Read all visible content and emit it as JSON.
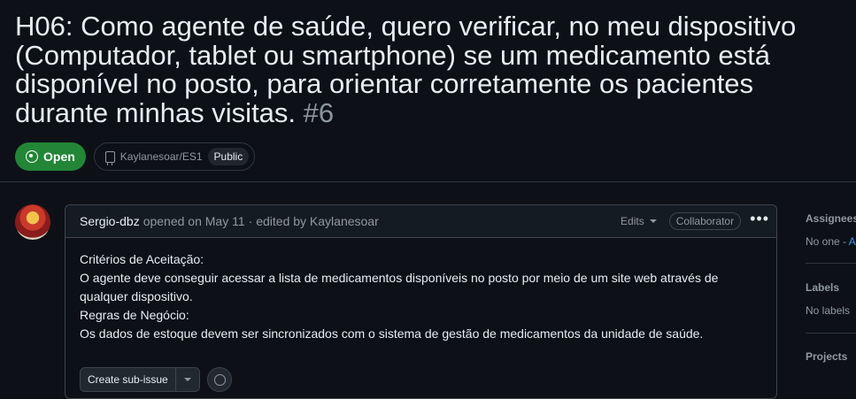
{
  "issue": {
    "title": "H06: Como agente de saúde, quero verificar, no meu dispositivo (Computador, tablet ou smartphone) se um medicamento está disponível no posto, para orientar corretamente os pacientes durante minhas visitas.",
    "number": "#6",
    "state": "Open",
    "repo": "Kaylanesoar/ES1",
    "visibility": "Public"
  },
  "comment": {
    "author": "Sergio-dbz",
    "opened_text": "opened on May 11",
    "edited_text": "· edited by Kaylanesoar",
    "edits_label": "Edits",
    "role_badge": "Collaborator",
    "more_icon": "kebab-horizontal-icon",
    "body": [
      "Critérios de Aceitação:",
      "O agente deve conseguir acessar a lista de medicamentos disponíveis no posto por meio de um site web através de qualquer dispositivo.",
      "Regras de Negócio:",
      "Os dados de estoque devem ser sincronizados com o sistema de gestão de medicamentos da unidade de saúde."
    ],
    "create_subissue_label": "Create sub-issue"
  },
  "sidebar": {
    "assignees": {
      "title": "Assignees",
      "value": "No one -",
      "link": "A"
    },
    "labels": {
      "title": "Labels",
      "value": "No labels"
    },
    "projects": {
      "title": "Projects"
    }
  },
  "colors": {
    "background": "#0d1117",
    "open_badge": "#238636",
    "text": "#e6edf3",
    "muted": "#9198a1",
    "link": "#4493f8",
    "border": "#30363d"
  }
}
